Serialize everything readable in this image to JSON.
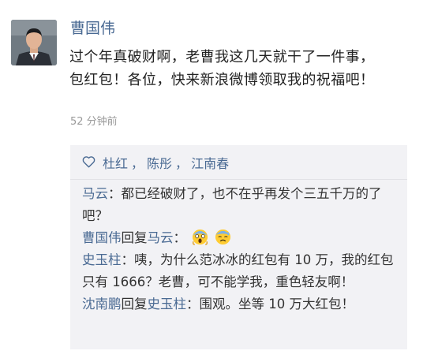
{
  "post": {
    "author": "曹国伟",
    "text": "过个年真破财啊，老曹我这几天就干了一件事，包红包！各位，快来新浪微博领取我的祝福吧！",
    "time": "52 分钟前"
  },
  "likes": {
    "icon": "heart-outline-icon",
    "names": [
      "杜红",
      "陈彤",
      "江南春"
    ],
    "separator": "，"
  },
  "comments": [
    {
      "author": "马云",
      "colon": "：",
      "text": "都已经破财了，也不在乎再发个三五千万的了吧？"
    },
    {
      "author": "曹国伟",
      "reply_word": "回复",
      "reply_to": "马云",
      "colon": "：",
      "emojis": [
        "scream-emoji",
        "anxious-sweat-emoji"
      ]
    },
    {
      "author": "史玉柱",
      "colon": "：",
      "text": "咦，为什么范冰冰的红包有 10 万，我的红包只有 1666？老曹，可不能学我，重色轻友啊！"
    },
    {
      "author": "沈南鹏",
      "reply_word": "回复",
      "reply_to": "史玉柱",
      "colon": "：",
      "text": "围观。坐等 10 万大红包！"
    }
  ],
  "colors": {
    "link": "#4a6a93",
    "panel_bg": "#f2f2f5",
    "time": "#9a9a9a"
  }
}
